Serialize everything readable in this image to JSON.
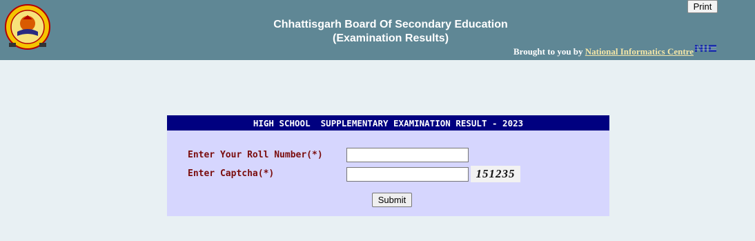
{
  "header": {
    "title_line1": "Chhattisgarh Board Of Secondary Education",
    "title_line2": "(Examination Results)",
    "print_label": "Print",
    "credit_prefix": "Brought to you by ",
    "credit_link": "National Informatics Centre",
    "logo_icon": "cgbse-emblem-icon",
    "nic_icon": "nic-logo-icon"
  },
  "panel": {
    "heading": "HIGH SCHOOL  SUPPLEMENTARY EXAMINATION RESULT - 2023",
    "roll_label": "Enter Your Roll Number(*)",
    "roll_value": "",
    "captcha_label": "Enter Captcha(*)",
    "captcha_value": "",
    "captcha_code": "151235",
    "submit_label": "Submit"
  },
  "colors": {
    "header_bg": "#5f8795",
    "page_bg": "#e8f0f3",
    "panel_head_bg": "#000080",
    "panel_bg": "#d6d6fe",
    "label_color": "#7a0c0c"
  }
}
